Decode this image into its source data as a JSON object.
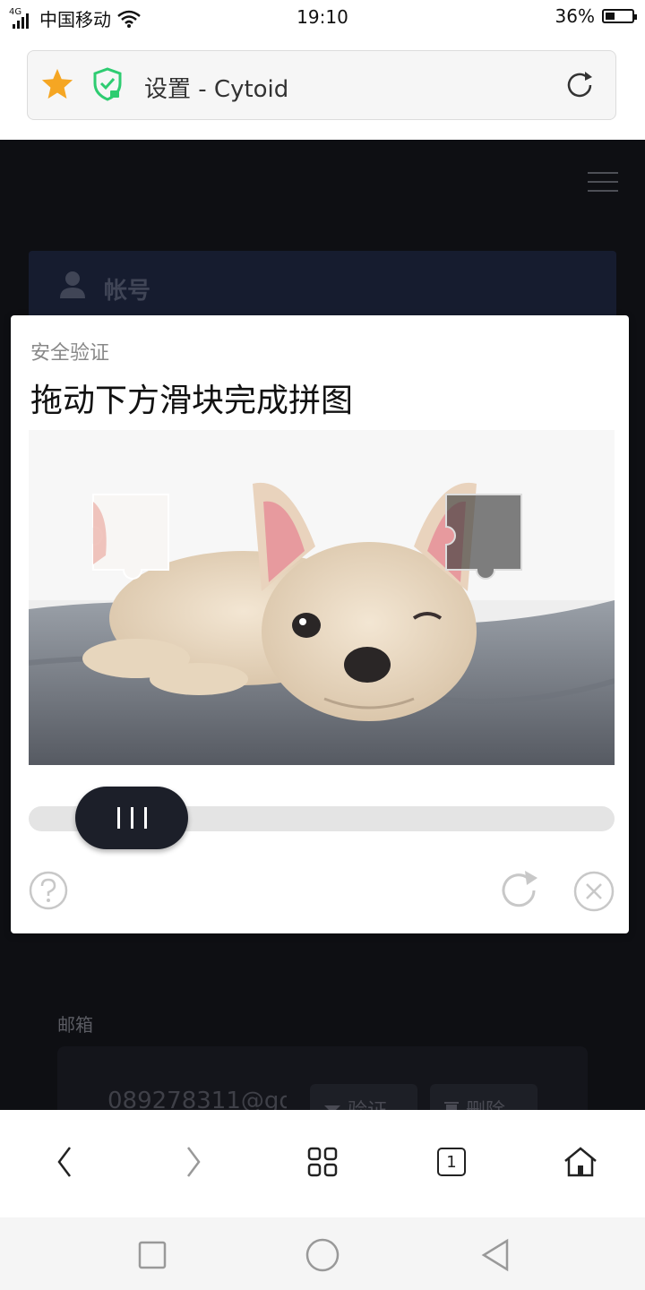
{
  "status_bar": {
    "network": "4G",
    "carrier": "中国移动",
    "time": "19:10",
    "battery": "36%",
    "battery_level": 0.36
  },
  "browser": {
    "page_title": "设置 - Cytoid",
    "tab_count": "1"
  },
  "webpage": {
    "account_section_title": "帐号",
    "email_label": "邮箱",
    "email_value": "089278311@gq",
    "verify_button": "验证",
    "delete_button": "删除"
  },
  "captcha": {
    "subtitle": "安全验证",
    "title": "拖动下方滑块完成拼图",
    "slider_progress": 0.08
  },
  "colors": {
    "accent_star": "#f5a623",
    "shield_green": "#2ecc71",
    "slider_thumb": "#1c1f29",
    "page_background": "#111217"
  }
}
